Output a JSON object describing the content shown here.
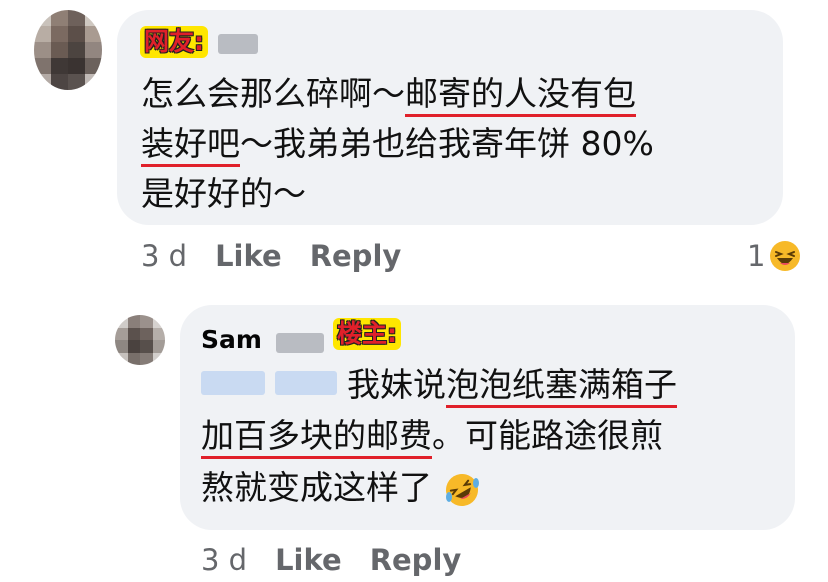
{
  "comment_1": {
    "author_label": "网友:",
    "lines": [
      [
        "怎么会那么碎啊～",
        "邮寄的人没有包"
      ],
      [
        "装好吧",
        "～我弟弟也给我寄年饼 80%"
      ],
      [
        "是好好的～"
      ]
    ],
    "time": "3 d",
    "like_label": "Like",
    "reply_label": "Reply",
    "reaction_count": "1",
    "reaction_icon": "laughing-emoji-icon"
  },
  "comment_2": {
    "author_name": "Sam",
    "author_label": "楼主:",
    "lines": [
      [
        "我妹说",
        "泡泡纸塞满箱子"
      ],
      [
        "加百多块的邮费",
        "。可能路途很煎"
      ],
      [
        "熬就变成这样了"
      ]
    ],
    "emoji": "rolling-on-floor-laughing-icon",
    "time": "3 d",
    "like_label": "Like",
    "reply_label": "Reply"
  },
  "colors": {
    "bubble": "#f0f2f5",
    "label_bg": "#ffe600",
    "label_text": "#e0202a",
    "underline": "#e0202a",
    "meta": "#65676b"
  }
}
